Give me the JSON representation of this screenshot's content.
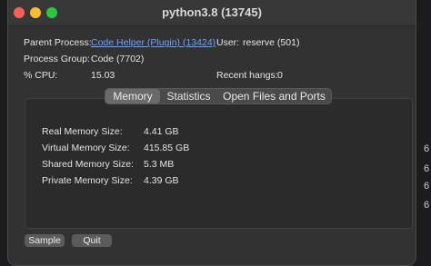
{
  "window": {
    "title": "python3.8 (13745)"
  },
  "info": {
    "parent_process_label": "Parent Process:",
    "parent_process_value": "Code Helper (Plugin) (13424)",
    "user_label": "User:",
    "user_value": "reserve (501)",
    "process_group_label": "Process Group:",
    "process_group_value": "Code (7702)",
    "cpu_label": "% CPU:",
    "cpu_value": "15.03",
    "recent_hangs_label": "Recent hangs:",
    "recent_hangs_value": "0"
  },
  "tabs": [
    "Memory",
    "Statistics",
    "Open Files and Ports"
  ],
  "memory": [
    {
      "label": "Real Memory Size:",
      "value": "4.41 GB"
    },
    {
      "label": "Virtual Memory Size:",
      "value": "415.85 GB"
    },
    {
      "label": "Shared Memory Size:",
      "value": "5.3 MB"
    },
    {
      "label": "Private Memory Size:",
      "value": "4.39 GB"
    }
  ],
  "buttons": {
    "sample": "Sample",
    "quit": "Quit"
  },
  "background": {
    "chars": [
      "6",
      "6",
      "6",
      "6"
    ]
  }
}
